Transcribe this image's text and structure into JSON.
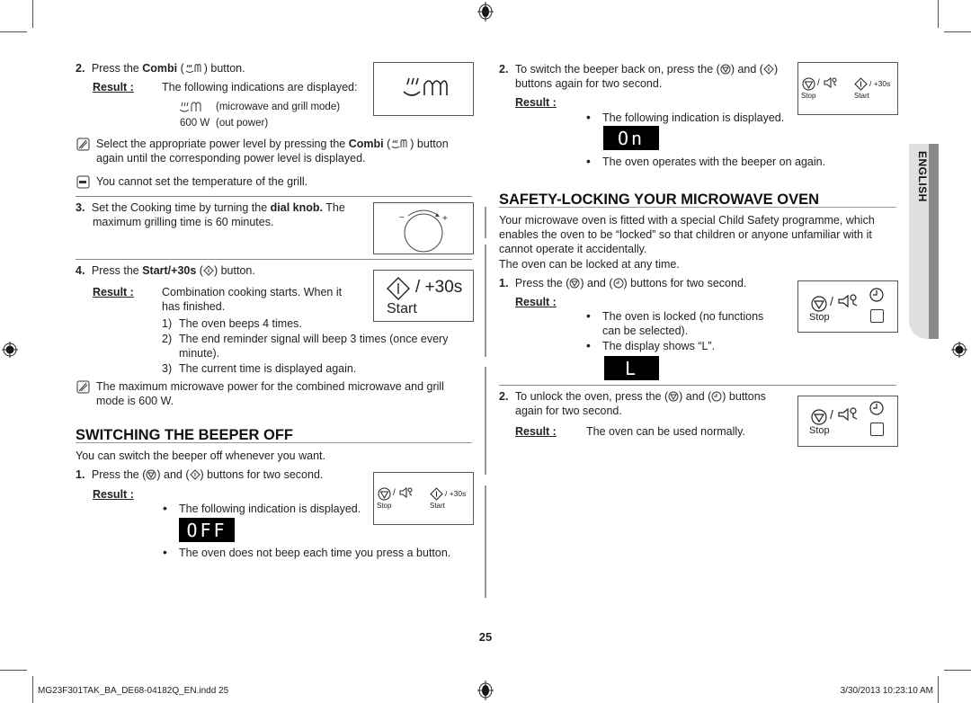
{
  "left": {
    "step2": {
      "num": "2.",
      "pre": "Press the ",
      "combi": "Combi",
      "post": " button.",
      "result_label": "Result :",
      "result_text": "The following indications are displayed:",
      "ind1_desc": "(microwave and grill mode)",
      "ind2_value": "600 W",
      "ind2_desc": "(out power)"
    },
    "note1": {
      "line1_pre": "Select the appropriate power level by pressing the ",
      "line1_bold": "Combi",
      "line1_post": " button",
      "line2": "again until the corresponding power level is displayed."
    },
    "note2": "You cannot set the temperature of the grill.",
    "step3": {
      "num": "3.",
      "line1_pre": "Set the Cooking time by turning the ",
      "line1_bold": "dial knob.",
      "line1_post": " The",
      "line2": "maximum grilling time is 60 minutes.",
      "dial_minus": "−",
      "dial_plus": "+"
    },
    "step4": {
      "num": "4.",
      "pre": "Press the ",
      "bold": "Start/+30s",
      "post": " button.",
      "result_label": "Result :",
      "result_line1": "Combination cooking starts. When it",
      "result_line2": "has finished.",
      "items": [
        {
          "n": "1)",
          "text": "The oven beeps 4 times."
        },
        {
          "n": "2)",
          "text": "The end reminder signal will beep 3 times (once every"
        },
        {
          "n": "",
          "text": "minute)."
        },
        {
          "n": "3)",
          "text": "The current time is displayed again."
        }
      ],
      "panel_label": "/ +30s",
      "panel_start": "Start"
    },
    "note3": {
      "line1": "The maximum microwave power for the combined microwave and grill",
      "line2": "mode is 600 W."
    },
    "beeper": {
      "heading": "SWITCHING THE BEEPER OFF",
      "intro": "You can switch the beeper off whenever you want.",
      "step1_num": "1.",
      "step1_pre": "Press the (",
      "step1_mid": ") and (",
      "step1_post": ") buttons for two second.",
      "result_label": "Result :",
      "bullet1": "The following indication is displayed.",
      "display": "OFF",
      "bullet2": "The oven does not beep each time you press a button."
    }
  },
  "right": {
    "step2": {
      "num": "2.",
      "line1_pre": "To switch the beeper back on, press the (",
      "line1_mid": ") and (",
      "line1_post": ")",
      "line2": "buttons again for two second.",
      "result_label": "Result :",
      "bullet1": "The following indication is displayed.",
      "display": "On",
      "bullet2": "The oven operates with the beeper on again."
    },
    "safety": {
      "heading": "SAFETY-LOCKING YOUR MICROWAVE OVEN",
      "para": [
        "Your microwave oven is fitted with a special Child Safety programme, which",
        "enables the oven to be “locked” so that children or anyone unfamiliar with it",
        "cannot operate it accidentally.",
        "The oven can be locked at any time."
      ],
      "step1": {
        "num": "1.",
        "pre": "Press the (",
        "mid": ") and (",
        "post": ") buttons for two second.",
        "result_label": "Result :",
        "bullet1_l1": "The oven is locked (no functions",
        "bullet1_l2": "can be selected).",
        "bullet2": "The display shows “L”.",
        "display": "L"
      },
      "step2": {
        "num": "2.",
        "line1_pre": "To unlock the oven, press the (",
        "line1_mid": ") and (",
        "line1_post": ") buttons",
        "line2": "again for two second.",
        "result_label": "Result :",
        "result_text": "The oven can be used normally."
      }
    }
  },
  "panel": {
    "stop": "Stop",
    "start": "Start",
    "plus30": "/ +30s",
    "slash": "/"
  },
  "side_tab": "ENGLISH",
  "page_number": "25",
  "footer": {
    "file": "MG23F301TAK_BA_DE68-04182Q_EN.indd   25",
    "timestamp": "3/30/2013   10:23:10 AM"
  },
  "colors": {
    "tab_light": "#e0e0e0",
    "tab_dark": "#8a8a8a",
    "rule": "#888888",
    "lcd_bg": "#000000"
  }
}
